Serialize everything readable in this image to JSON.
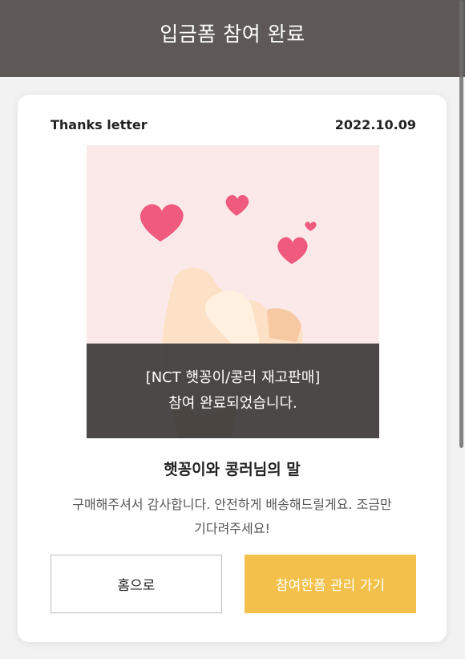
{
  "header": {
    "title": "입금폼 참여 완료"
  },
  "card": {
    "label": "Thanks letter",
    "date": "2022.10.09",
    "image": {
      "icon": "finger-heart-image",
      "overlay_line1": "[NCT 햇꽁이/콩러 재고판매]",
      "overlay_line2": "참여 완료되었습니다."
    },
    "message_title": "햇꽁이와 콩러님의 말",
    "message_body": "구매해주셔서 감사합니다. 안전하게 배송해드릴게요. 조금만 기다려주세요!"
  },
  "buttons": {
    "home_label": "홈으로",
    "manage_label": "참여한폼 관리 가기"
  },
  "colors": {
    "header_bg": "#5e5956",
    "accent": "#f3c14b",
    "image_bg": "#fbe9ea"
  }
}
